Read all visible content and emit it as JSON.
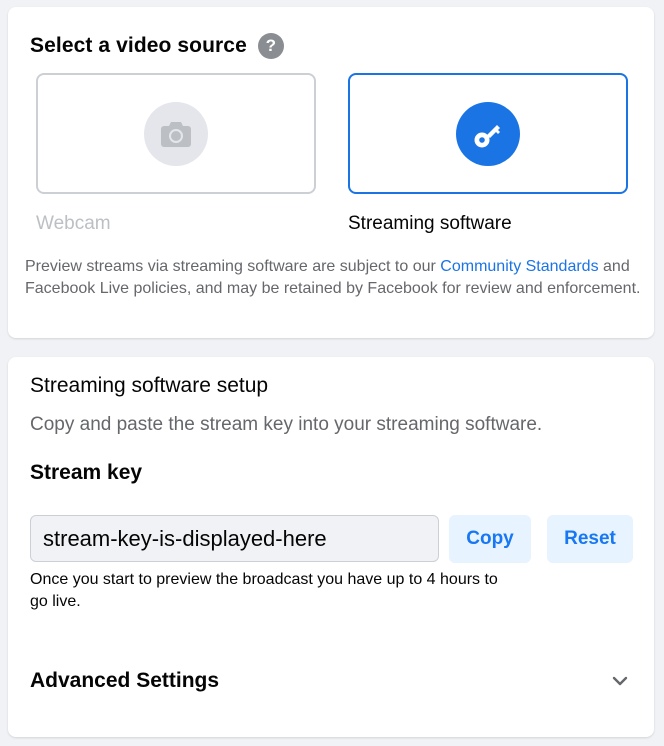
{
  "source_card": {
    "title": "Select a video source",
    "help_icon_glyph": "?",
    "options": [
      {
        "id": "webcam",
        "label": "Webcam",
        "icon": "camera-icon",
        "selected": false
      },
      {
        "id": "software",
        "label": "Streaming software",
        "icon": "key-icon",
        "selected": true
      }
    ],
    "notice_pre": "Preview streams via streaming software are subject to our ",
    "notice_link": "Community Standards",
    "notice_post": " and Facebook Live policies, and may be retained by Facebook for review and enforcement."
  },
  "setup_card": {
    "title": "Streaming software setup",
    "description": "Copy and paste the stream key into your streaming software.",
    "key_heading": "Stream key",
    "stream_key_value": "stream-key-is-displayed-here",
    "copy_label": "Copy",
    "reset_label": "Reset",
    "hint": "Once you start to preview the broadcast you have up to 4 hours to go live.",
    "advanced_label": "Advanced Settings"
  },
  "colors": {
    "accent": "#1b74e4",
    "button_bg": "#e7f3ff",
    "muted_text": "#65676b",
    "disabled_text": "#bcc0c4",
    "page_bg": "#f0f2f5"
  }
}
